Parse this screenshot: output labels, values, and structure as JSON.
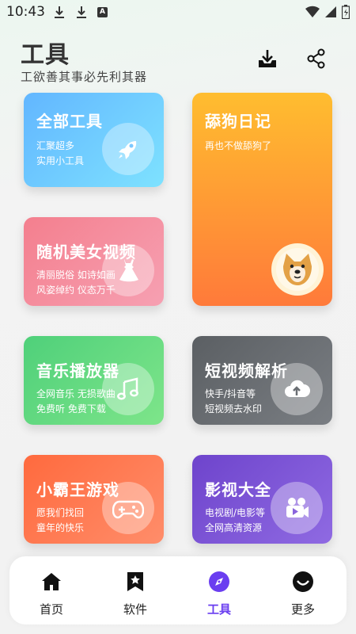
{
  "status_bar": {
    "time": "10:43"
  },
  "header": {
    "title": "工具",
    "subtitle": "工欲善其事必先利其器",
    "download_icon": "download-icon",
    "share_icon": "share-icon"
  },
  "cards": [
    {
      "title": "全部工具",
      "desc1": "汇聚超多",
      "desc2": "实用小工具",
      "icon": "rocket-icon",
      "color": "#6ec6ff"
    },
    {
      "title": "舔狗日记",
      "desc1": "再也不做舔狗了",
      "desc2": "",
      "icon": "doge-avatar",
      "color": "#ffa033"
    },
    {
      "title": "随机美女视频",
      "desc1": "清丽脱俗 如诗如画",
      "desc2": "风姿绰约 仪态万千",
      "icon": "dress-icon",
      "color": "#f38a9b"
    },
    {
      "title": "音乐播放器",
      "desc1": "全网音乐 无损歌曲",
      "desc2": "免费听 免费下载",
      "icon": "music-note-icon",
      "color": "#5fd47a"
    },
    {
      "title": "短视频解析",
      "desc1": "快手/抖音等",
      "desc2": "短视频去水印",
      "icon": "cloud-upload-icon",
      "color": "#5f6368"
    },
    {
      "title": "小霸王游戏",
      "desc1": "愿我们找回",
      "desc2": "童年的快乐",
      "icon": "gamepad-icon",
      "color": "#ff7850"
    },
    {
      "title": "影视大全",
      "desc1": "电视剧/电影等",
      "desc2": "全网高清资源",
      "icon": "video-camera-icon",
      "color": "#7d56d6"
    }
  ],
  "nav": [
    {
      "label": "首页",
      "icon": "home-icon",
      "active": false
    },
    {
      "label": "软件",
      "icon": "bookmark-star-icon",
      "active": false
    },
    {
      "label": "工具",
      "icon": "compass-icon",
      "active": true
    },
    {
      "label": "更多",
      "icon": "smile-icon",
      "active": false
    }
  ],
  "colors": {
    "accent": "#6a3ef0"
  }
}
